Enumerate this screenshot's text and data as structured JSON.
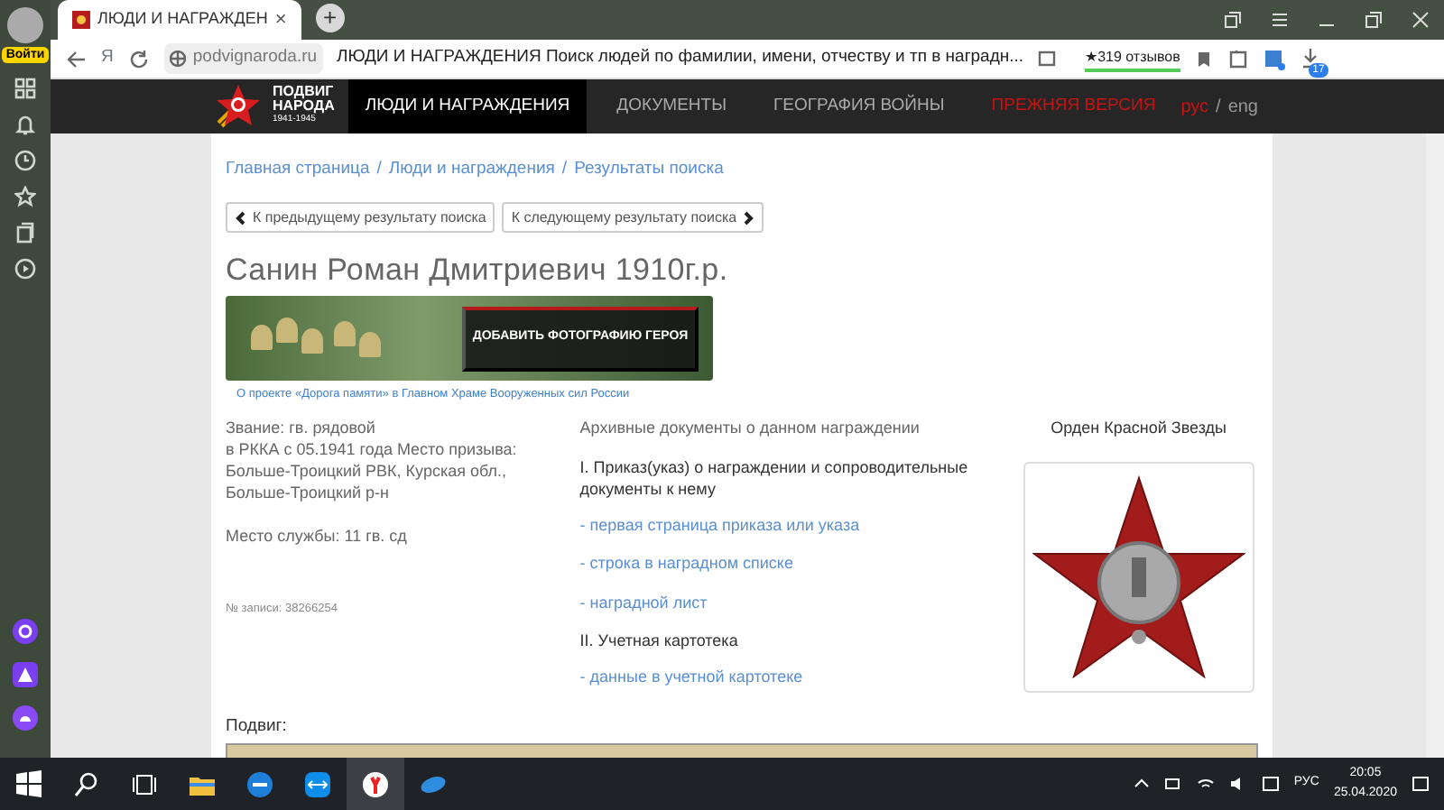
{
  "browser": {
    "login_badge": "Войти",
    "tab": {
      "title": "ЛЮДИ И НАГРАЖДЕН",
      "close": "×"
    },
    "new_tab": "+",
    "address": {
      "yandex": "Я",
      "url": "podvignaroda.ru",
      "page_title": "ЛЮДИ И НАГРАЖДЕНИЯ Поиск людей по фамилии, имени, отчеству и тп в наградн...",
      "reviews": "★319 отзывов",
      "downloads_count": "17"
    }
  },
  "site": {
    "logo": {
      "line1": "ПОДВИГ",
      "line2": "НАРОДА",
      "years": "1941-1945"
    },
    "nav": [
      {
        "label": "ЛЮДИ И НАГРАЖДЕНИЯ",
        "selected": true,
        "kind": "normal"
      },
      {
        "label": "ДОКУМЕНТЫ",
        "selected": false,
        "kind": "normal"
      },
      {
        "label": "ГЕОГРАФИЯ ВОЙНЫ",
        "selected": false,
        "kind": "normal"
      },
      {
        "label": "ПРЕЖНЯЯ ВЕРСИЯ",
        "selected": false,
        "kind": "highlight"
      }
    ],
    "languages": [
      {
        "label": "рус",
        "selected": true
      },
      {
        "label": "eng",
        "selected": false
      }
    ],
    "language_separator": "/"
  },
  "breadcrumbs": {
    "items": [
      "Главная страница",
      "Люди и награждения",
      "Результаты поиска"
    ],
    "separator": "/"
  },
  "pager": [
    {
      "label": "К предыдущему результату поиска"
    },
    {
      "label": "К следующему результату поиска"
    }
  ],
  "person": {
    "title": "Санин Роман Дмитриевич 1910г.р.",
    "add_photo": "ДОБАВИТЬ ФОТОГРАФИЮ ГЕРОЯ",
    "banner_caption": "О проекте «Дорога памяти» в Главном Храме Вооруженных сил России",
    "details": [
      "Звание: гв. рядовой",
      "в РККА с 05.1941 года Место призыва: Больше-Троицкий РВК, Курская обл., Больше-Троицкий р-н",
      "Место службы: 11 гв. сд"
    ],
    "record": "№ записи: 38266254"
  },
  "archive": {
    "heading": "Архивные документы о данном награждении",
    "sections": [
      {
        "title": "I. Приказ(указ) о награждении и сопроводительные документы к нему",
        "links": [
          "- первая страница приказа или указа",
          "- строка в наградном списке",
          "- наградной лист"
        ]
      },
      {
        "title": "II. Учетная картотека",
        "links": [
          "- данные в учетной картотеке"
        ]
      }
    ]
  },
  "award": {
    "title": "Орден Красной Звезды"
  },
  "feat_label": "Подвиг:",
  "taskbar": {
    "language": "РУС",
    "time": "20:05",
    "date": "25.04.2020"
  }
}
